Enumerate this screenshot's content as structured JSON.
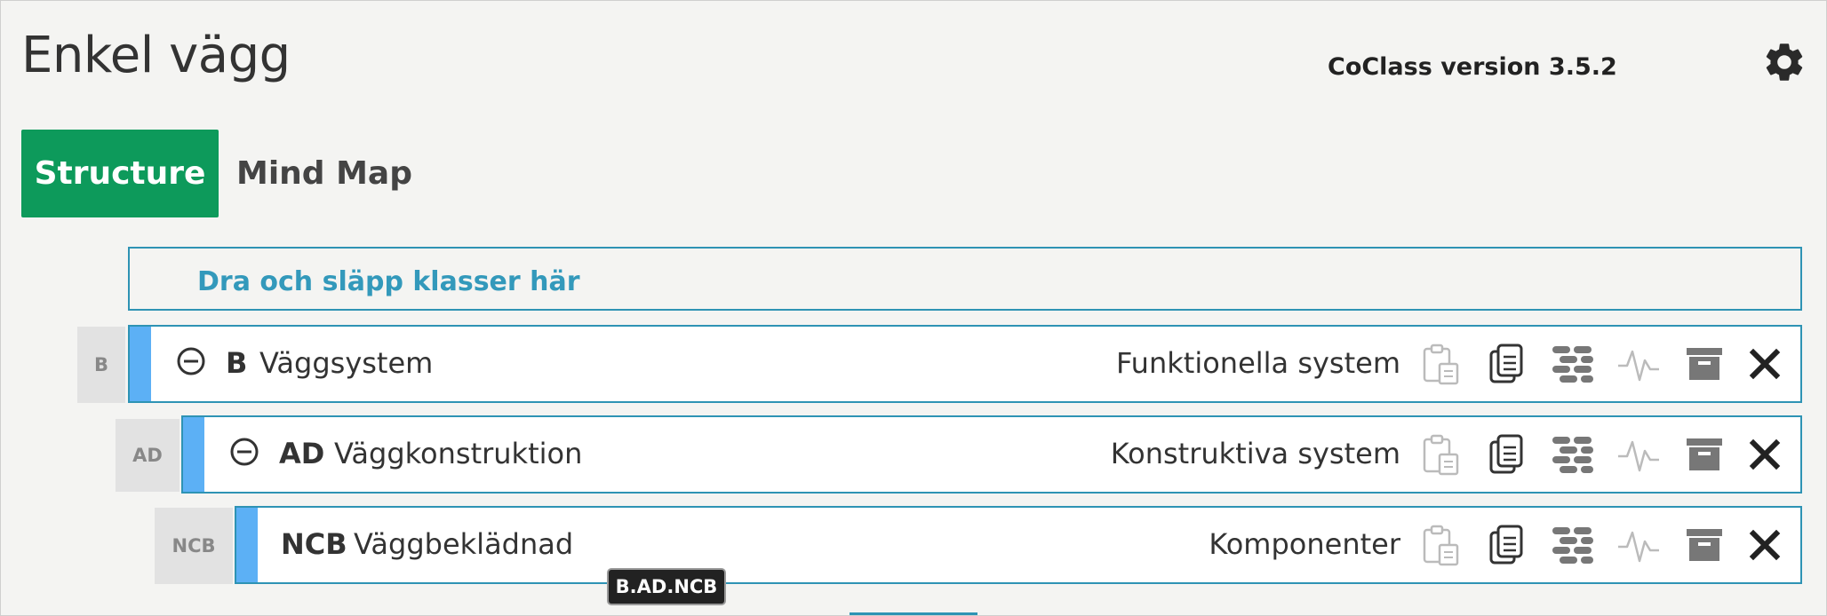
{
  "header": {
    "title": "Enkel vägg",
    "version": "CoClass version 3.5.2"
  },
  "tabs": [
    {
      "label": "Structure",
      "active": true
    },
    {
      "label": "Mind Map",
      "active": false
    }
  ],
  "dropzone": {
    "label": "Dra och släpp klasser här"
  },
  "rows": [
    {
      "badge": "B",
      "code": "B",
      "name": "Väggsystem",
      "category": "Funktionella system",
      "collapsible": true
    },
    {
      "badge": "AD",
      "code": "AD",
      "name": "Väggkonstruktion",
      "category": "Konstruktiva system",
      "collapsible": true
    },
    {
      "badge": "NCB",
      "code": "NCB",
      "name": "Väggbeklädnad",
      "category": "Komponenter",
      "collapsible": false
    }
  ],
  "tooltip": {
    "text": "B.AD.NCB"
  },
  "colors": {
    "accent_green": "#0d9a5b",
    "row_border": "#2e93b4",
    "stripe_blue": "#5cb0f5",
    "dropzone_text": "#3399bb"
  },
  "icons": {
    "settings": "gear-icon",
    "collapse": "minus-circle-icon",
    "actions": [
      "clipboard-icon",
      "copy-icon",
      "bricks-icon",
      "activity-icon",
      "archive-icon",
      "close-icon"
    ]
  }
}
